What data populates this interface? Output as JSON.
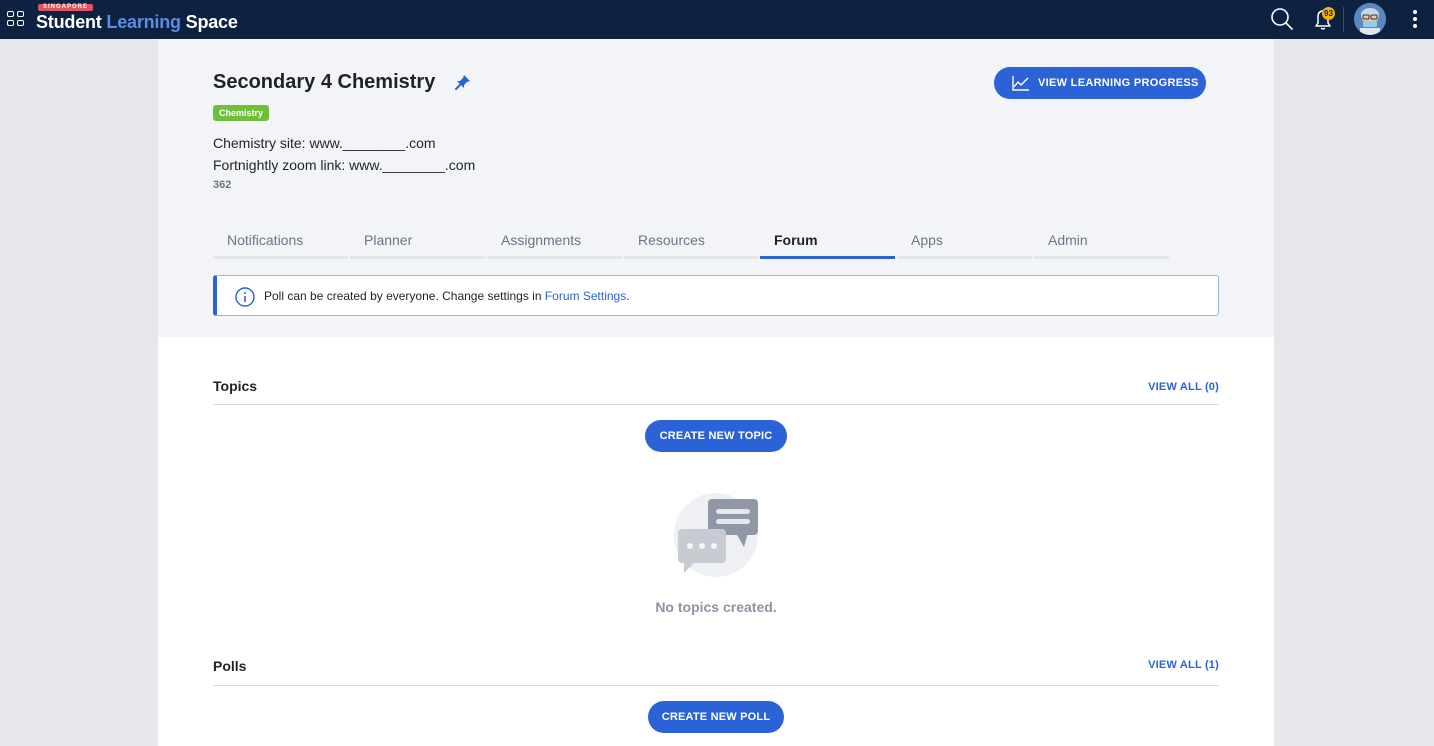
{
  "topbar": {
    "brand_tag": "SINGAPORE",
    "brand_part1": "Student",
    "brand_part2": "Learning",
    "brand_part3": "Space",
    "notification_count": "93",
    "icons": [
      "apps-grid-icon",
      "search-icon",
      "bell-icon",
      "avatar",
      "more-vertical-icon"
    ]
  },
  "course": {
    "title": "Secondary 4 Chemistry",
    "subject_tag": "Chemistry",
    "description_lines": [
      "Chemistry site: www.________.com",
      "Fortnightly zoom link: www.________.com"
    ],
    "count": "362",
    "view_progress_label": "VIEW LEARNING PROGRESS"
  },
  "tabs": [
    {
      "label": "Notifications",
      "active": false
    },
    {
      "label": "Planner",
      "active": false
    },
    {
      "label": "Assignments",
      "active": false
    },
    {
      "label": "Resources",
      "active": false
    },
    {
      "label": "Forum",
      "active": true
    },
    {
      "label": "Apps",
      "active": false
    },
    {
      "label": "Admin",
      "active": false
    }
  ],
  "info_banner": {
    "text": "Poll can be created by everyone. Change settings in ",
    "link": "Forum Settings",
    "suffix": "."
  },
  "topics": {
    "title": "Topics",
    "view_all": "VIEW ALL (0)",
    "create_label": "CREATE NEW TOPIC",
    "empty_text": "No topics created."
  },
  "polls": {
    "title": "Polls",
    "view_all": "VIEW ALL (1)",
    "create_label": "CREATE NEW POLL"
  },
  "colors": {
    "nav_bg": "#0d2140",
    "accent": "#2b63d6",
    "tag_green": "#6fbf3b",
    "badge_yellow": "#f0b400"
  }
}
